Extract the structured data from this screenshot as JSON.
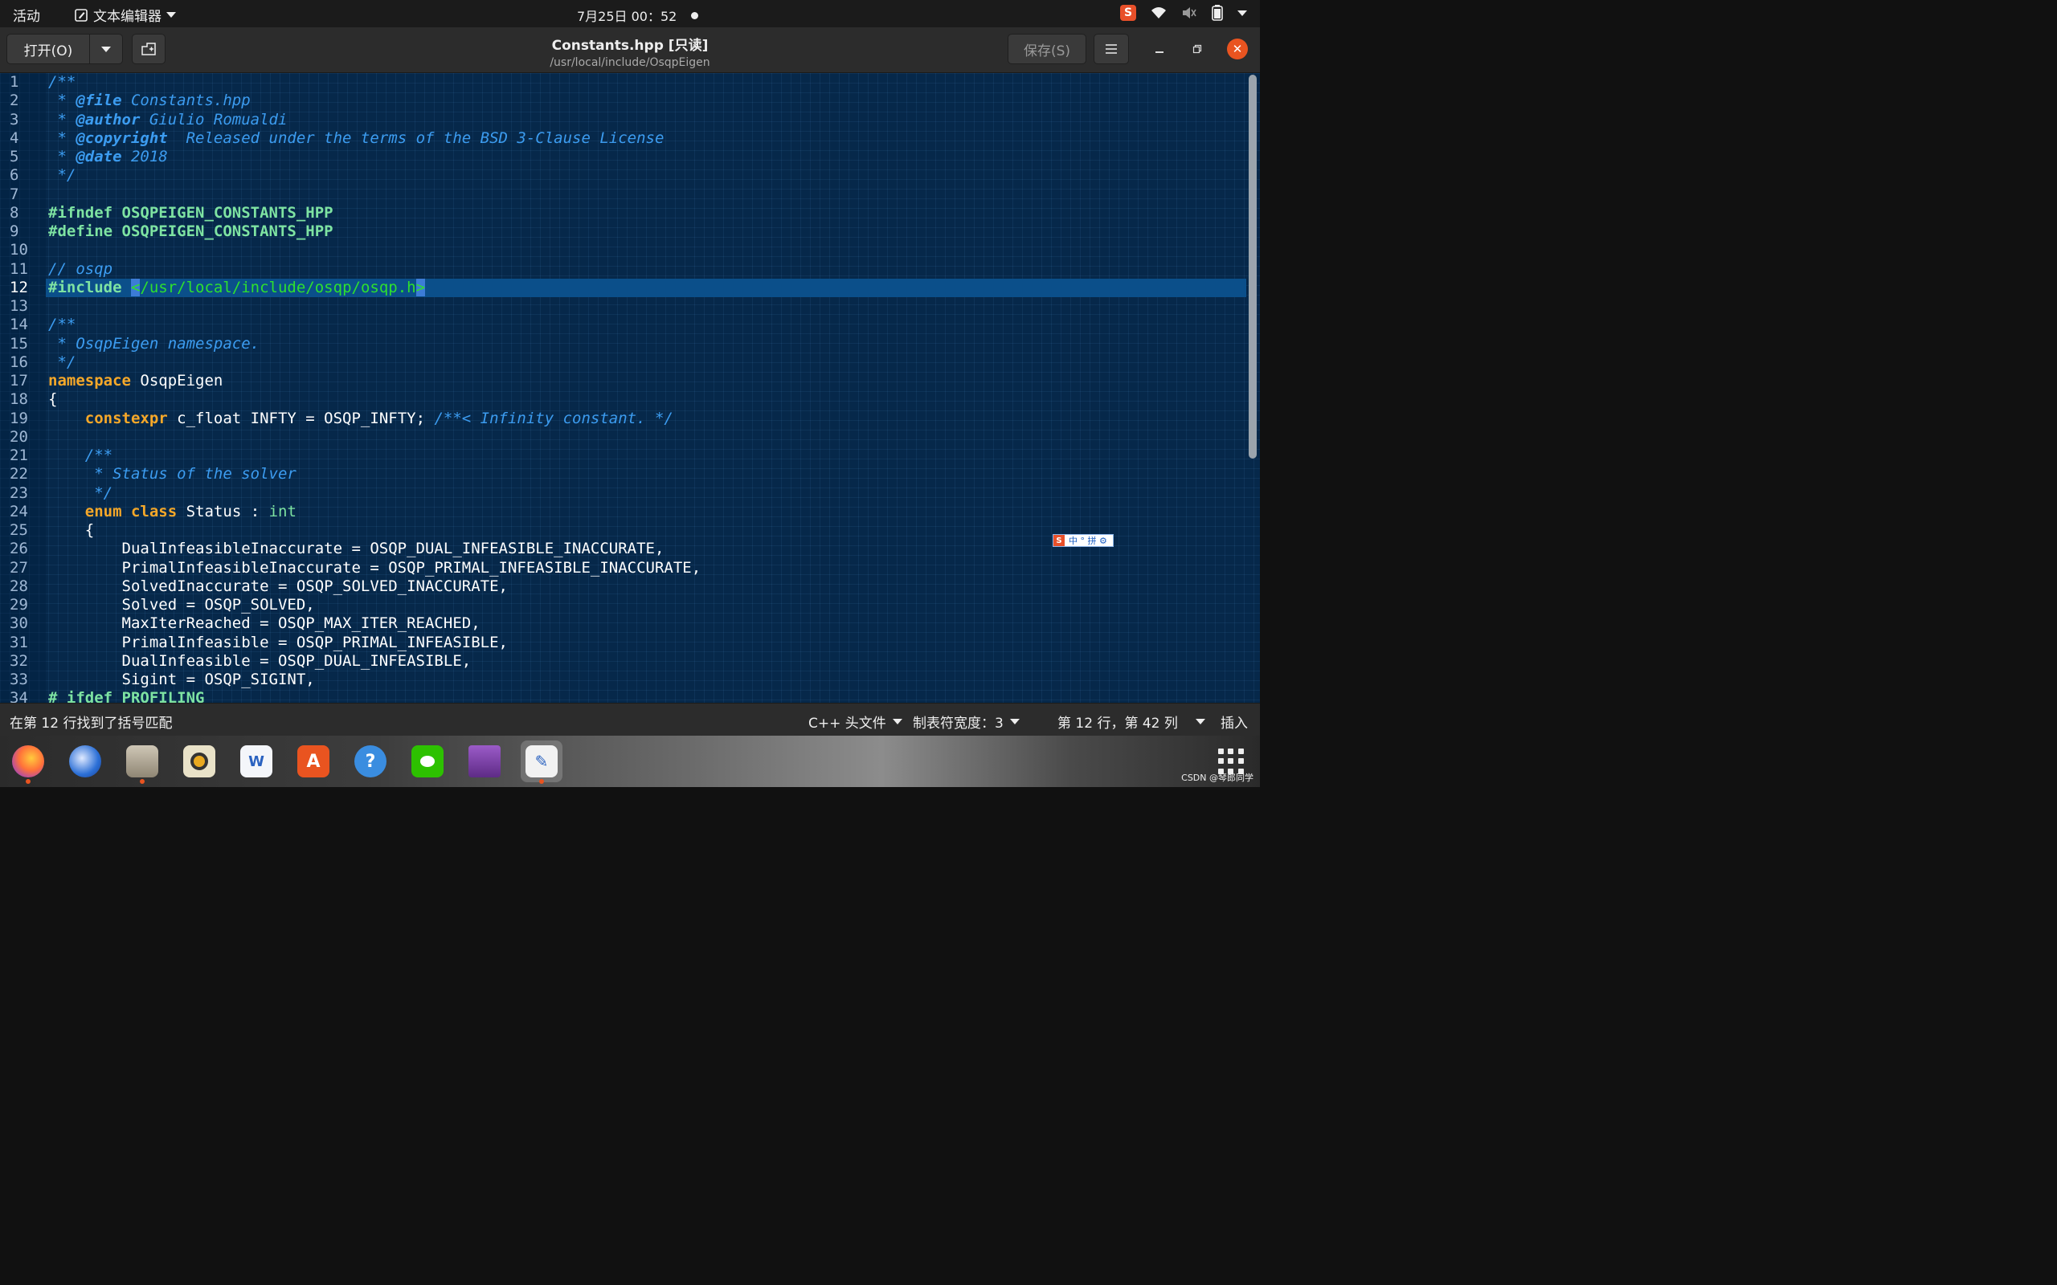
{
  "topbar": {
    "activities": "活动",
    "app_menu": "文本编辑器",
    "clock": "7月25日  00：52"
  },
  "headerbar": {
    "open_label": "打开(O)",
    "title": "Constants.hpp [只读]",
    "subtitle": "/usr/local/include/OsqpEigen",
    "save_label": "保存(S)"
  },
  "editor": {
    "current_line": 12,
    "lines": [
      {
        "n": "1"
      },
      {
        "n": "2"
      },
      {
        "n": "3"
      },
      {
        "n": "4"
      },
      {
        "n": "5"
      },
      {
        "n": "6"
      },
      {
        "n": "7"
      },
      {
        "n": "8"
      },
      {
        "n": "9"
      },
      {
        "n": "10"
      },
      {
        "n": "11"
      },
      {
        "n": "12"
      },
      {
        "n": "13"
      },
      {
        "n": "14"
      },
      {
        "n": "15"
      },
      {
        "n": "16"
      },
      {
        "n": "17"
      },
      {
        "n": "18"
      },
      {
        "n": "19"
      },
      {
        "n": "20"
      },
      {
        "n": "21"
      },
      {
        "n": "22"
      },
      {
        "n": "23"
      },
      {
        "n": "24"
      },
      {
        "n": "25"
      },
      {
        "n": "26"
      },
      {
        "n": "27"
      },
      {
        "n": "28"
      },
      {
        "n": "29"
      },
      {
        "n": "30"
      },
      {
        "n": "31"
      },
      {
        "n": "32"
      },
      {
        "n": "33"
      },
      {
        "n": "34"
      }
    ],
    "code": {
      "l1": "/**",
      "l2_a": " * ",
      "l2_tag": "@file",
      "l2_b": " Constants.hpp",
      "l3_a": " * ",
      "l3_tag": "@author",
      "l3_b": " Giulio Romualdi",
      "l4_a": " * ",
      "l4_tag": "@copyright",
      "l4_b": "  Released under the terms of the BSD 3-Clause License",
      "l5_a": " * ",
      "l5_tag": "@date",
      "l5_b": " 2018",
      "l6": " */",
      "l8": "#ifndef OSQPEIGEN_CONSTANTS_HPP",
      "l9": "#define OSQPEIGEN_CONSTANTS_HPP",
      "l11": "// osqp",
      "l12_pre": "#include ",
      "l12_lt": "<",
      "l12_path": "/usr/local/include/osqp/osqp.h",
      "l12_gt": ">",
      "l14": "/**",
      "l15": " * OsqpEigen namespace.",
      "l16": " */",
      "l17_kw": "namespace",
      "l17_b": " OsqpEigen",
      "l18": "{",
      "l19_ind": "    ",
      "l19_kw": "constexpr",
      "l19_b": " c_float INFTY = OSQP_INFTY; ",
      "l19_c": "/**< Infinity constant. */",
      "l21": "    /**",
      "l22": "     * Status of the solver",
      "l23": "     */",
      "l24_ind": "    ",
      "l24_kw1": "enum",
      "l24_sp": " ",
      "l24_kw2": "class",
      "l24_b": " Status : ",
      "l24_type": "int",
      "l25": "    {",
      "l26": "        DualInfeasibleInaccurate = OSQP_DUAL_INFEASIBLE_INACCURATE,",
      "l27": "        PrimalInfeasibleInaccurate = OSQP_PRIMAL_INFEASIBLE_INACCURATE,",
      "l28": "        SolvedInaccurate = OSQP_SOLVED_INACCURATE,",
      "l29": "        Solved = OSQP_SOLVED,",
      "l30": "        MaxIterReached = OSQP_MAX_ITER_REACHED,",
      "l31": "        PrimalInfeasible = OSQP_PRIMAL_INFEASIBLE,",
      "l32": "        DualInfeasible = OSQP_DUAL_INFEASIBLE,",
      "l33": "        Sigint = OSQP_SIGINT,",
      "l34": "# ifdef PROFILING"
    }
  },
  "ime": {
    "label": "中 ° 拼 ⚙"
  },
  "statusbar": {
    "message": "在第 12 行找到了括号匹配",
    "language": "C++ 头文件",
    "tab_width": "制表符宽度：3",
    "position": "第 12 行，第 42 列",
    "mode": "插入"
  },
  "dock": {
    "apps": [
      "firefox-icon",
      "thunderbird-icon",
      "files-icon",
      "rhythmbox-icon",
      "libreoffice-writer-icon",
      "software-center-icon",
      "help-icon",
      "wechat-icon",
      "video-icon",
      "text-editor-icon"
    ]
  },
  "watermark": "CSDN @琴郎同学",
  "colors": {
    "editor_bg": "#06284a",
    "comment": "#3c9cf0",
    "keyword": "#f6a829",
    "preprocessor": "#7ee3a2",
    "string": "#2ee02e",
    "accent": "#e95420"
  }
}
